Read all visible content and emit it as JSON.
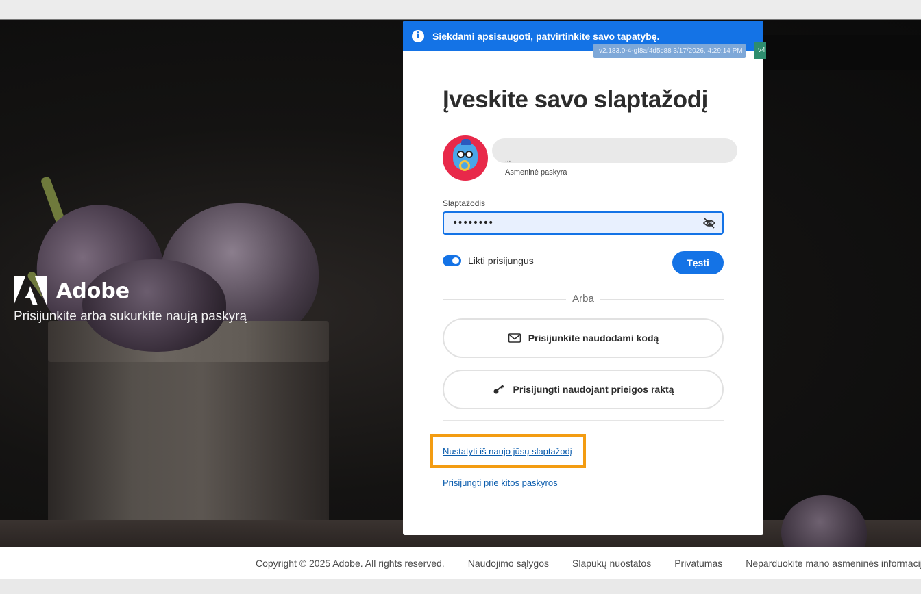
{
  "banner": {
    "text": "Siekdami apsisaugoti, patvirtinkite savo tapatybę.",
    "icon": "info-icon"
  },
  "version": {
    "text": "v2.183.0-4-gf8af4d5c88 3/17/2026, 4:29:14 PM",
    "side": "v4"
  },
  "brand": {
    "name": "Adobe",
    "tagline": "Prisijunkite arba sukurkite naują paskyrą"
  },
  "card": {
    "title": "Įveskite savo slaptažodį",
    "account_dots": "...",
    "account_type": "Asmeninė paskyra",
    "password_label": "Slaptažodis",
    "password_value": "••••••••",
    "stay_signed_in_label": "Likti prisijungus",
    "stay_signed_in": true,
    "continue_label": "Tęsti",
    "or_label": "Arba",
    "code_button_label": "Prisijunkite naudodami kodą",
    "passkey_button_label": "Prisijungti naudojant prieigos raktą",
    "reset_link": "Nustatyti iš naujo jūsų slaptažodį",
    "other_account_link": "Prisijungti prie kitos paskyros"
  },
  "footer": {
    "copyright": "Copyright © 2025 Adobe. All rights reserved.",
    "links": [
      "Naudojimo sąlygos",
      "Slapukų nuostatos",
      "Privatumas",
      "Neparduokite mano asmeninės informacijos ir ja n"
    ]
  },
  "colors": {
    "accent": "#1473e6",
    "highlight": "#f39c12",
    "link": "#0a5cad"
  }
}
